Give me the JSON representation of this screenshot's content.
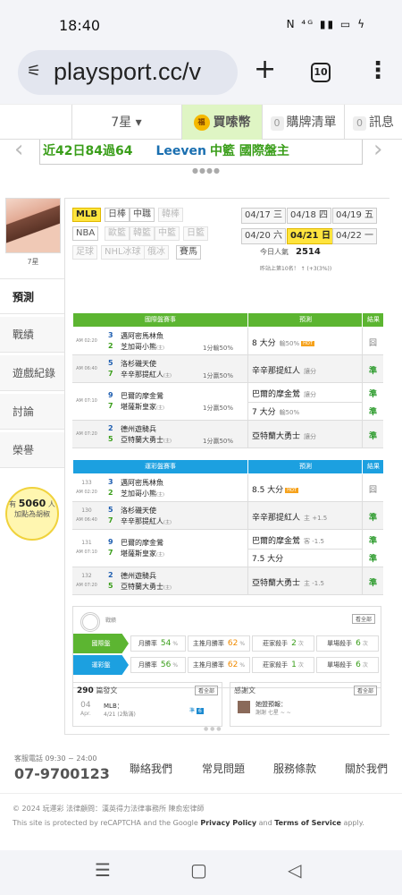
{
  "status": {
    "time": "18:40",
    "icons": "N ⁴ᴳ ▮▮ ▭ ϟ"
  },
  "browser": {
    "url": "playsport.cc/v",
    "tab_count": "10",
    "plus": "+",
    "menu": "⋮"
  },
  "nav": {
    "user": "7星 ▾",
    "coin_icon": "福",
    "coin": "買嗦幣",
    "list_count": "0",
    "list": "購牌清單",
    "msg_count": "0",
    "msg": "訊息"
  },
  "banner": {
    "text1": "近42日84過64",
    "text2": "Leeven",
    "text3": "中籃 國際盤主"
  },
  "profile": {
    "name": "7星"
  },
  "side_menu": [
    "預測",
    "戰績",
    "遊戲紀錄",
    "討論",
    "榮譽"
  ],
  "bulb": {
    "prefix": "有",
    "count": "5060",
    "suffix": "人",
    "sub": "加點為胡椒"
  },
  "sports": [
    [
      {
        "t": "MLB",
        "s": "on"
      },
      {
        "t": "日棒",
        "s": ""
      },
      {
        "t": "中職",
        "s": ""
      },
      {
        "t": "韓棒",
        "s": "off"
      }
    ],
    [
      {
        "t": "NBA",
        "s": ""
      },
      {
        "t": "歐籃",
        "s": "off"
      },
      {
        "t": "韓籃",
        "s": "off"
      },
      {
        "t": "中籃",
        "s": "off"
      },
      {
        "t": "日籃",
        "s": "off"
      }
    ],
    [
      {
        "t": "足球",
        "s": "off"
      },
      {
        "t": "NHL冰球",
        "s": "off"
      },
      {
        "t": "俄冰",
        "s": "off"
      },
      {
        "t": "賽馬",
        "s": ""
      }
    ]
  ],
  "dates": [
    [
      {
        "t": "04/17 三",
        "s": ""
      },
      {
        "t": "04/18 四",
        "s": ""
      },
      {
        "t": "04/19 五",
        "s": ""
      }
    ],
    [
      {
        "t": "04/20 六",
        "s": ""
      },
      {
        "t": "04/21 日",
        "s": "on"
      },
      {
        "t": "04/22 一",
        "s": ""
      }
    ]
  ],
  "popularity": {
    "label": "今日人氣",
    "value": "2514",
    "rank": "昨站上第10名！ ↑ (+3(3%))"
  },
  "intl": {
    "headers": [
      "國際盤賽事",
      "預測",
      "結果"
    ],
    "games": [
      {
        "time": "AM 02:20",
        "n1": "3",
        "t1": "邁阿密馬林魚",
        "r1": "(主)",
        "n2": "2",
        "t2": "芝加哥小熊",
        "r2": "(主)",
        "line": "1分輸50%",
        "preds": [
          {
            "t": "8 大分",
            "s": "輸50%",
            "hot": "HOT"
          }
        ],
        "res": "囧",
        "alt": false
      },
      {
        "time": "AM 06:40",
        "n1": "5",
        "t1": "洛杉磯天使",
        "r1": "",
        "n2": "7",
        "t2": "辛辛那提紅人",
        "r2": "(主)",
        "line": "1分贏50%",
        "preds": [
          {
            "t": "辛辛那提紅人",
            "s": "讓分",
            "hot": ""
          }
        ],
        "res": "準",
        "alt": true
      },
      {
        "time": "AM 07:10",
        "n1": "9",
        "t1": "巴爾的摩金鶯",
        "r1": "",
        "n2": "7",
        "t2": "堪薩斯皇家",
        "r2": "(主)",
        "line": "1分贏50%",
        "preds": [
          {
            "t": "巴爾的摩金鶯",
            "s": "讓分",
            "hot": ""
          },
          {
            "t": "7 大分",
            "s": "輸50%",
            "hot": ""
          }
        ],
        "res": "準",
        "res2": "準",
        "alt": false
      },
      {
        "time": "AM 07:20",
        "n1": "2",
        "t1": "德州遊騎兵",
        "r1": "",
        "n2": "5",
        "t2": "亞特蘭大勇士",
        "r2": "(主)",
        "line": "1分贏50%",
        "preds": [
          {
            "t": "亞特蘭大勇士",
            "s": "讓分",
            "hot": ""
          }
        ],
        "res": "準",
        "alt": true
      }
    ]
  },
  "lottery": {
    "headers": [
      "運彩盤賽事",
      "預測",
      "結果"
    ],
    "games": [
      {
        "no": "133",
        "time": "AM 02:20",
        "n1": "3",
        "t1": "邁阿密馬林魚",
        "n2": "2",
        "t2": "芝加哥小熊",
        "r2": "(主)",
        "preds": [
          {
            "t": "8.5 大分",
            "s": "",
            "hot": "HOT"
          }
        ],
        "res": "囧",
        "alt": false
      },
      {
        "no": "130",
        "time": "AM 06:40",
        "n1": "5",
        "t1": "洛杉磯天使",
        "n2": "7",
        "t2": "辛辛那提紅人",
        "r2": "(主)",
        "preds": [
          {
            "t": "辛辛那提紅人",
            "s": "主 +1.5",
            "hot": ""
          }
        ],
        "res": "準",
        "alt": true
      },
      {
        "no": "131",
        "time": "AM 07:10",
        "n1": "9",
        "t1": "巴爾的摩金鶯",
        "n2": "7",
        "t2": "堪薩斯皇家",
        "r2": "(主)",
        "preds": [
          {
            "t": "巴爾的摩金鶯",
            "s": "客 -1.5",
            "hot": ""
          },
          {
            "t": "7.5 大分",
            "s": "",
            "hot": ""
          }
        ],
        "res": "準",
        "res2": "準",
        "alt": false
      },
      {
        "no": "132",
        "time": "AM 07:20",
        "n1": "2",
        "t1": "德州遊騎兵",
        "n2": "5",
        "t2": "亞特蘭大勇士",
        "r2": "(主)",
        "preds": [
          {
            "t": "亞特蘭大勇士",
            "s": "主 -1.5",
            "hot": ""
          }
        ],
        "res": "準",
        "alt": true
      }
    ]
  },
  "stats": {
    "title": "戰績",
    "more": "看全部",
    "rows": [
      {
        "label": "國際盤",
        "color": "#5cb531",
        "c1l": "月勝率",
        "c1v": "54",
        "c2l": "主推月勝率",
        "c2v": "62",
        "c3l": "莊家殺手",
        "c3v": "2",
        "c4l": "單場殺手",
        "c4v": "6",
        "pct": "%",
        "unit": "次"
      },
      {
        "label": "運彩盤",
        "color": "#1ca0e0",
        "c1l": "月勝率",
        "c1v": "56",
        "c2l": "主推月勝率",
        "c2v": "62",
        "c3l": "莊家殺手",
        "c3v": "1",
        "c4l": "單場殺手",
        "c4v": "6",
        "pct": "%",
        "unit": "次"
      }
    ]
  },
  "posts": {
    "count": "290",
    "label": "篇發文",
    "more": "看全部",
    "day": "04",
    "month": "Apr.",
    "title": "MLB：",
    "date": "4/21 (2點滿)",
    "badges": [
      "準",
      "6"
    ]
  },
  "thanks": {
    "label": "感謝文",
    "more": "看全部",
    "title": "她盟預報：",
    "sub": "謝謝 七星 ~ ~"
  },
  "footer": {
    "hours": "客服電話 09:30 ~ 24:00",
    "phone": "07-9700123",
    "links": [
      "聯絡我們",
      "常見問題",
      "服務條款",
      "關於我們"
    ],
    "copyright": "© 2024 玩運彩 法律顧問：漢英得力法律事務所 陳俞宏律師",
    "recaptcha_pre": "This site is protected by reCAPTCHA and the Google ",
    "privacy": "Privacy Policy",
    "and": " and ",
    "terms": "Terms of Service",
    "apply": " apply."
  },
  "sysnav": {
    "menu": "☰",
    "home": "▢",
    "back": "◁"
  }
}
